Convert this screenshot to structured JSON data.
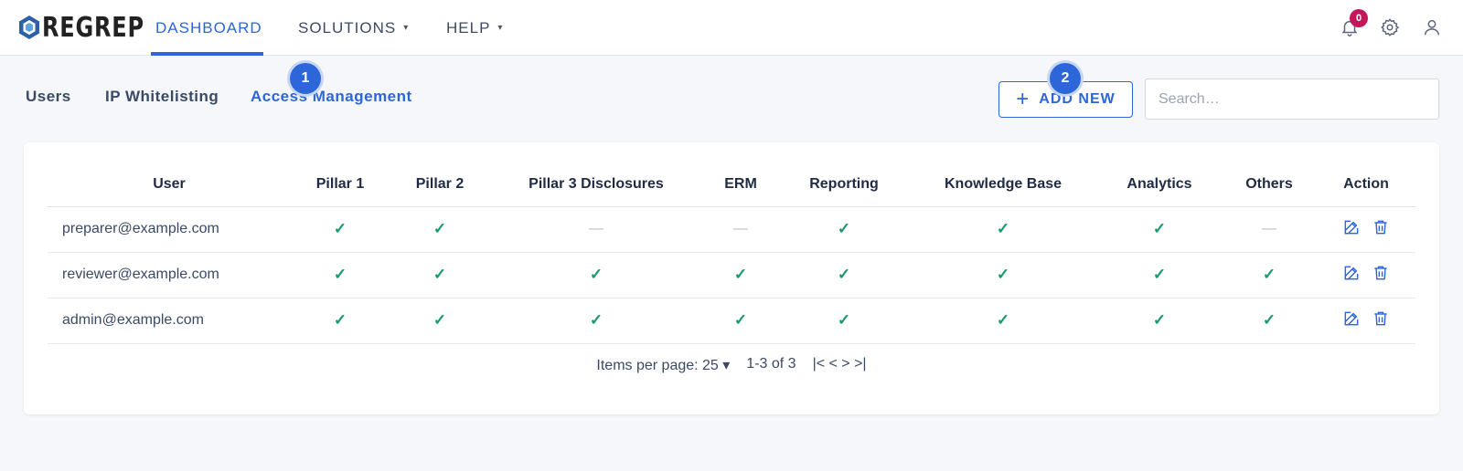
{
  "app": {
    "logo_text": "REGREP",
    "brand_color": "#2c66d8"
  },
  "nav": {
    "items": [
      {
        "label": "DASHBOARD",
        "active": true
      },
      {
        "label": "SOLUTIONS",
        "dropdown": "▾"
      },
      {
        "label": "HELP",
        "dropdown": "▾"
      }
    ],
    "notifications_count": "0",
    "icons": [
      "bell-icon",
      "gear-icon",
      "user-icon"
    ]
  },
  "subtabs": [
    {
      "label": "Users"
    },
    {
      "label": "IP Whitelisting"
    },
    {
      "label": "Access Management",
      "active": true
    }
  ],
  "markers": [
    "1",
    "2"
  ],
  "toolbar": {
    "add_label": "ADD NEW",
    "search_placeholder": "Search…"
  },
  "table": {
    "headers": [
      "User",
      "Pillar 1",
      "Pillar 2",
      "Pillar 3 Disclosures",
      "ERM",
      "Reporting",
      "Knowledge Base",
      "Analytics",
      "Others",
      "Action"
    ],
    "rows": [
      {
        "user": "preparer@example.com",
        "access": [
          "✓",
          "✓",
          "—",
          "—",
          "✓",
          "✓",
          "✓",
          "—"
        ]
      },
      {
        "user": "reviewer@example.com",
        "access": [
          "✓",
          "✓",
          "✓",
          "✓",
          "✓",
          "✓",
          "✓",
          "✓"
        ]
      },
      {
        "user": "admin@example.com",
        "access": [
          "✓",
          "✓",
          "✓",
          "✓",
          "✓",
          "✓",
          "✓",
          "✓"
        ]
      }
    ]
  },
  "pagination": {
    "items_per_page": "Items per page: 25 ▾",
    "range": "1-3 of 3",
    "controls": "|< < > >|"
  }
}
